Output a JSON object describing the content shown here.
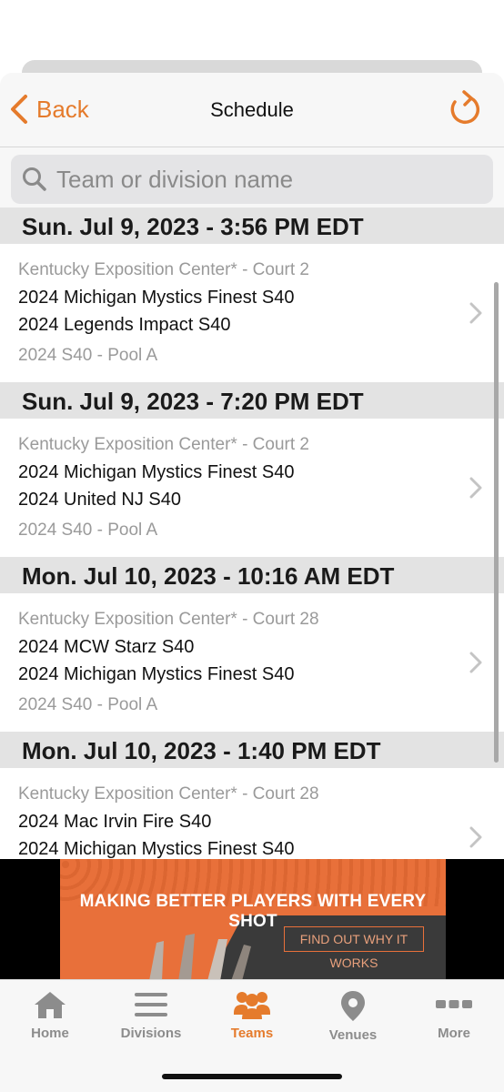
{
  "navbar": {
    "back_label": "Back",
    "title": "Schedule"
  },
  "search": {
    "placeholder": "Team or division name"
  },
  "games": [
    {
      "date": "Sun. Jul 9, 2023 - 3:56 PM EDT",
      "venue": "Kentucky Exposition Center* - Court 2",
      "team1": "2024 Michigan Mystics Finest S40",
      "team2": "2024 Legends Impact S40",
      "pool": "2024 S40 - Pool A"
    },
    {
      "date": "Sun. Jul 9, 2023 - 7:20 PM EDT",
      "venue": "Kentucky Exposition Center* - Court 2",
      "team1": "2024 Michigan Mystics Finest S40",
      "team2": "2024 United NJ S40",
      "pool": "2024 S40 - Pool A"
    },
    {
      "date": "Mon. Jul 10, 2023 - 10:16 AM EDT",
      "venue": "Kentucky Exposition Center* - Court 28",
      "team1": "2024 MCW Starz S40",
      "team2": "2024 Michigan Mystics Finest S40",
      "pool": "2024 S40 - Pool A"
    },
    {
      "date": "Mon. Jul 10, 2023 - 1:40 PM EDT",
      "venue": "Kentucky Exposition Center* - Court 28",
      "team1": "2024 Mac Irvin Fire S40",
      "team2": "2024 Michigan Mystics Finest S40",
      "pool": ""
    }
  ],
  "ad": {
    "headline": "MAKING BETTER PLAYERS WITH EVERY SHOT",
    "cta": "FIND OUT WHY IT WORKS"
  },
  "tabs": [
    {
      "label": "Home",
      "icon": "home-icon"
    },
    {
      "label": "Divisions",
      "icon": "list-icon"
    },
    {
      "label": "Teams",
      "icon": "teams-icon"
    },
    {
      "label": "Venues",
      "icon": "location-pin-icon"
    },
    {
      "label": "More",
      "icon": "more-icon"
    }
  ],
  "colors": {
    "accent": "#e57b2c",
    "header_bg": "#e3e3e3",
    "muted_text": "#9a9a9a",
    "tab_inactive": "#8c8c8c"
  }
}
